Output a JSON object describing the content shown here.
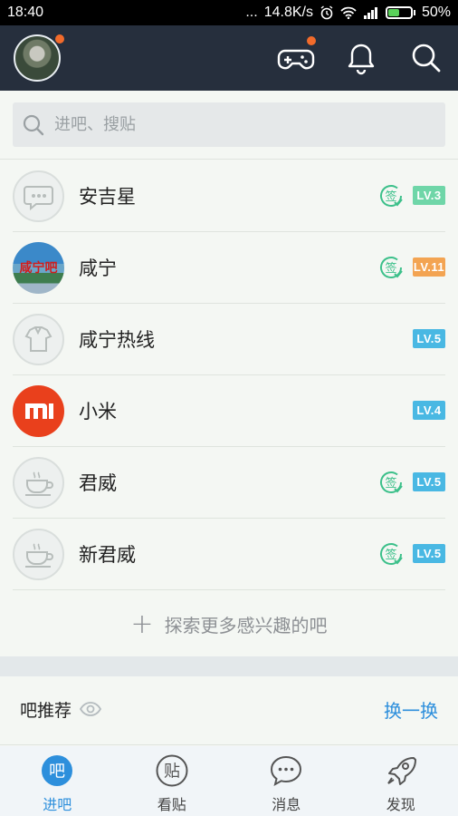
{
  "status_bar": {
    "time": "18:40",
    "signal_text": "...",
    "speed": "14.8K/s",
    "battery": "50%",
    "battery_level": 0.5
  },
  "header": {
    "icons": [
      "avatar",
      "gamepad-icon",
      "bell-icon",
      "search-icon"
    ],
    "notification_color": "#f26b2b"
  },
  "search": {
    "placeholder": "进吧、搜贴"
  },
  "forums": [
    {
      "name": "安吉星",
      "signed": true,
      "level": "LV.3",
      "level_color": "#6fd6a8"
    },
    {
      "name": "咸宁",
      "signed": true,
      "level": "LV.11",
      "level_color": "#f3a452",
      "logo_text": "咸宁吧"
    },
    {
      "name": "咸宁热线",
      "signed": false,
      "level": "LV.5",
      "level_color": "#49b8e3"
    },
    {
      "name": "小米",
      "signed": false,
      "level": "LV.4",
      "level_color": "#49b8e3",
      "logo_text": "mi"
    },
    {
      "name": "君威",
      "signed": true,
      "level": "LV.5",
      "level_color": "#49b8e3"
    },
    {
      "name": "新君威",
      "signed": true,
      "level": "LV.5",
      "level_color": "#49b8e3"
    }
  ],
  "sign_badge_text": "签",
  "explore": {
    "label": "探索更多感兴趣的吧"
  },
  "recommend": {
    "label": "吧推荐",
    "change_label": "换一换"
  },
  "tabs": [
    {
      "label": "进吧",
      "icon_text": "吧",
      "active": true
    },
    {
      "label": "看贴",
      "icon_text": "贴",
      "active": false
    },
    {
      "label": "消息",
      "icon_text": "...",
      "active": false
    },
    {
      "label": "发现",
      "icon_text": "",
      "active": false
    }
  ],
  "colors": {
    "accent": "#2d8fdc",
    "header_bg": "#262f3d",
    "sign_green": "#3cc08a"
  }
}
